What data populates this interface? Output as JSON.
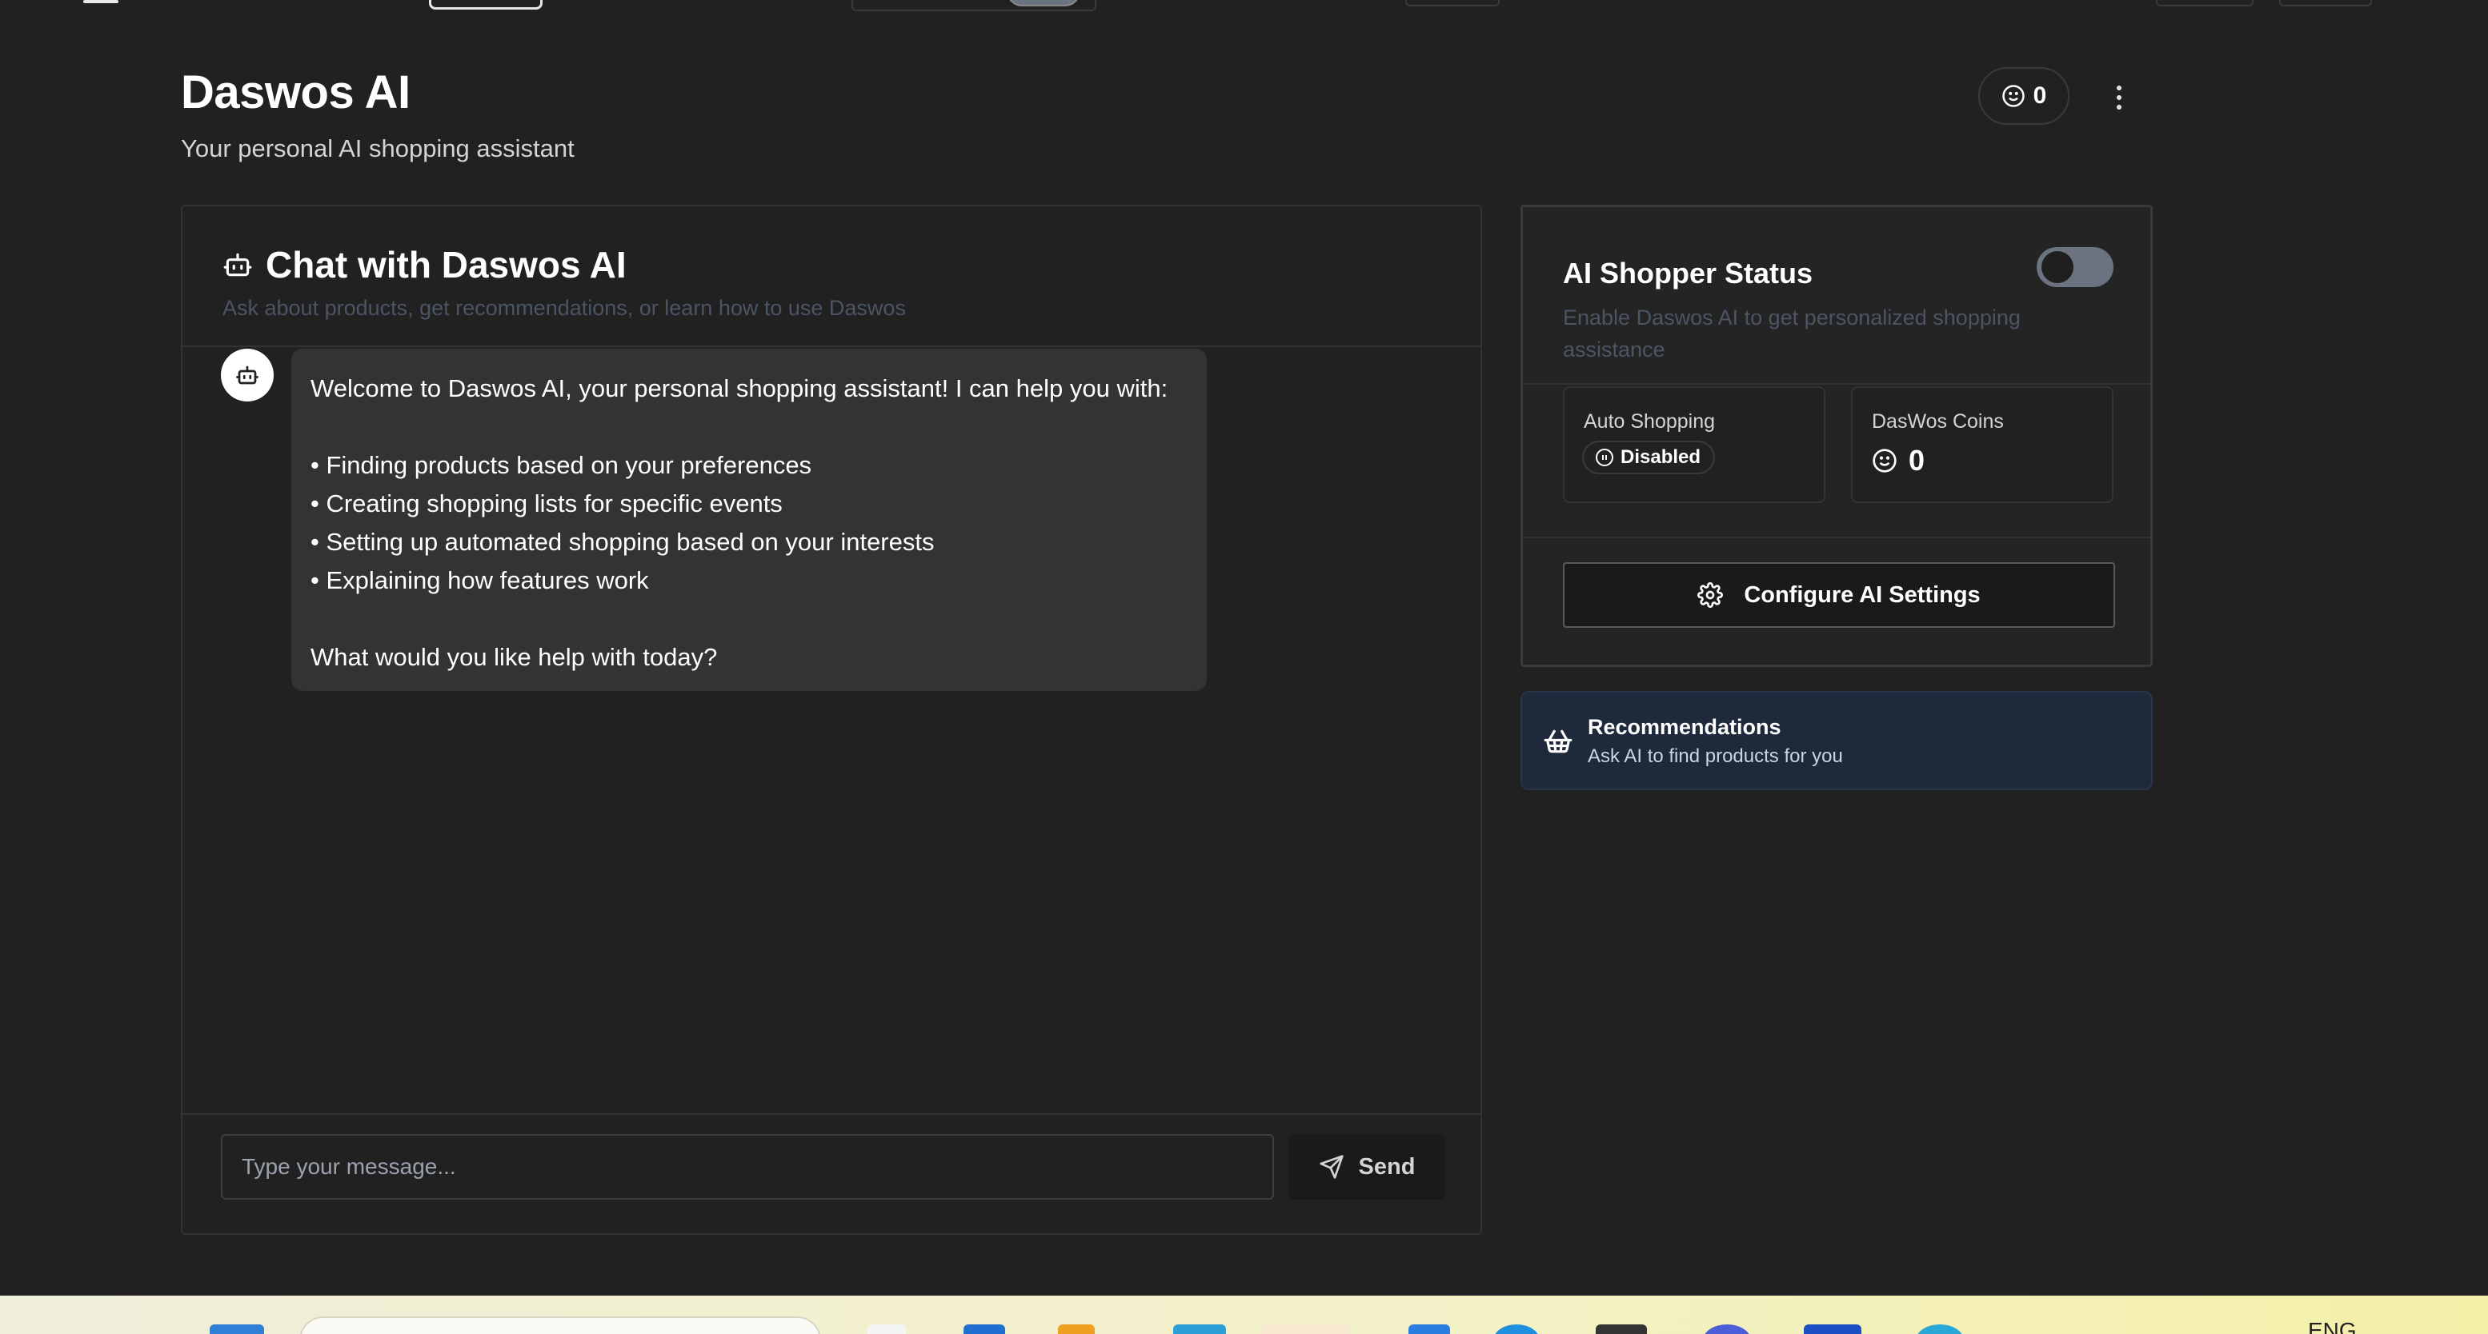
{
  "page": {
    "title": "Daswos AI",
    "subtitle": "Your personal AI shopping assistant",
    "coin_count": "0"
  },
  "chat": {
    "title": "Chat with Daswos AI",
    "description": "Ask about products, get recommendations, or learn how to use Daswos",
    "message": {
      "intro": "Welcome to Daswos AI, your personal shopping assistant! I can help you with:",
      "bullets": [
        "• Finding products based on your preferences",
        "• Creating shopping lists for specific events",
        "• Setting up automated shopping based on your interests",
        "• Explaining how features work"
      ],
      "closing": "What would you like help with today?"
    },
    "input_placeholder": "Type your message...",
    "send_label": "Send"
  },
  "status": {
    "title": "AI Shopper Status",
    "description": "Enable Daswos AI to get personalized shopping assistance",
    "toggle_on": false,
    "auto_shopping_label": "Auto Shopping",
    "auto_shopping_value": "Disabled",
    "coins_label": "DasWos Coins",
    "coins_value": "0",
    "configure_label": "Configure AI Settings"
  },
  "recommendations": {
    "title": "Recommendations",
    "subtitle": "Ask AI to find products for you"
  },
  "taskbar": {
    "language": "ENG"
  },
  "icons": [
    "coin-icon",
    "more-vertical-icon",
    "bot-icon",
    "send-icon",
    "pause-icon",
    "gear-icon",
    "basket-icon",
    "windows-start-icon"
  ]
}
